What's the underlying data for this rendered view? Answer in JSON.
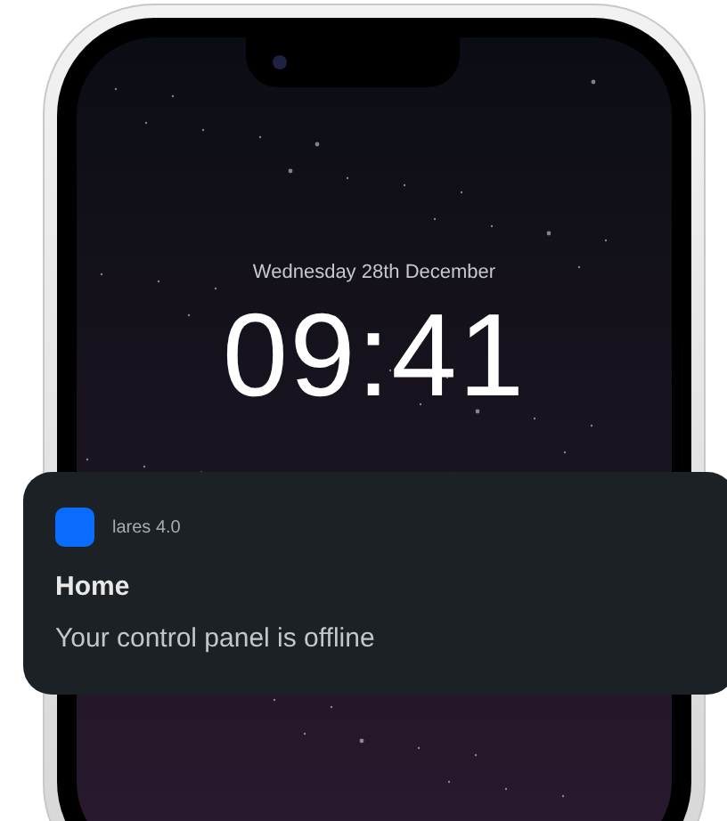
{
  "lock_screen": {
    "date": "Wednesday 28th December",
    "time": "09:41"
  },
  "notification": {
    "app_name": "lares 4.0",
    "title": "Home",
    "message": "Your control panel is offline"
  }
}
